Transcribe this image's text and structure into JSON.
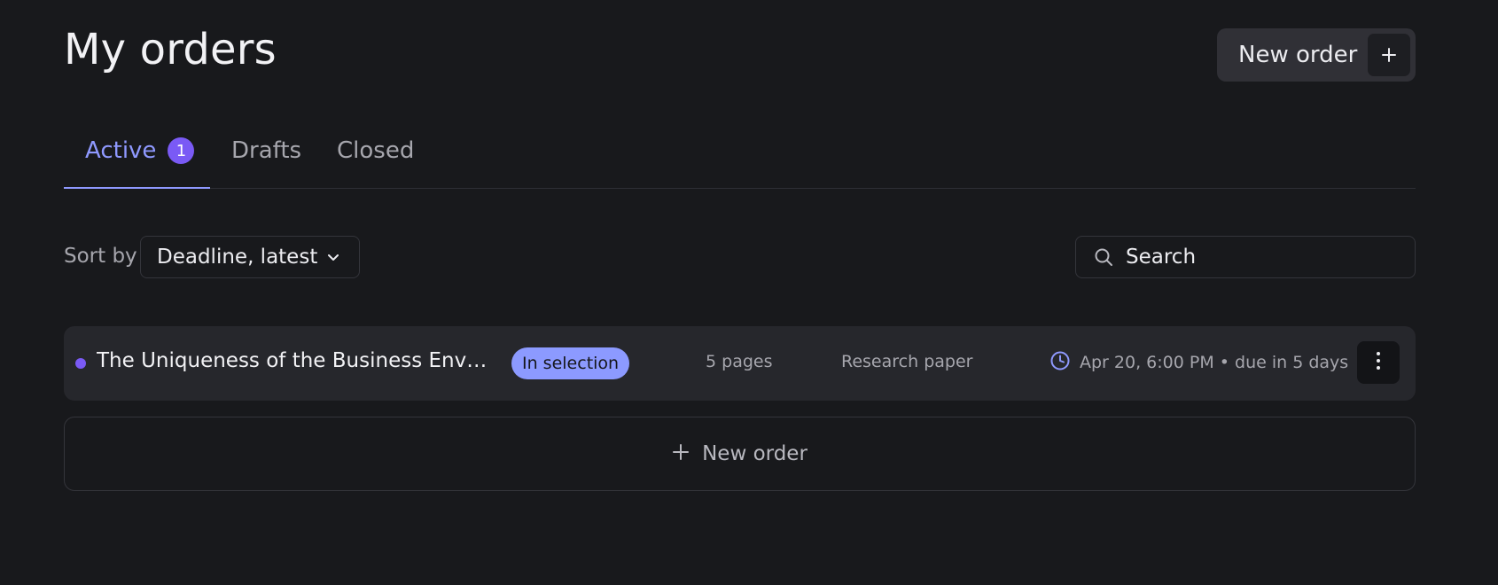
{
  "header": {
    "title": "My orders",
    "new_order_label": "New order"
  },
  "tabs": [
    {
      "label": "Active",
      "badge": "1",
      "active": true
    },
    {
      "label": "Drafts",
      "active": false
    },
    {
      "label": "Closed",
      "active": false
    }
  ],
  "toolbar": {
    "sort_label": "Sort by",
    "sort_value": "Deadline, latest",
    "search_placeholder": "Search"
  },
  "orders": [
    {
      "title": "The Uniqueness of the Business Environm…",
      "status": "In selection",
      "pages": "5 pages",
      "type": "Research paper",
      "deadline": "Apr 20, 6:00 PM • due in 5 days"
    }
  ],
  "new_order_card": {
    "label": "New order"
  },
  "icons": {
    "plus": "plus-icon",
    "chevron": "chevron-down-icon",
    "search": "search-icon",
    "clock": "clock-icon",
    "more": "more-vertical-icon"
  },
  "colors": {
    "accent": "#8f99ff",
    "badge": "#7a5af5",
    "status_badge": "#8c9aff",
    "background": "#18191c"
  }
}
